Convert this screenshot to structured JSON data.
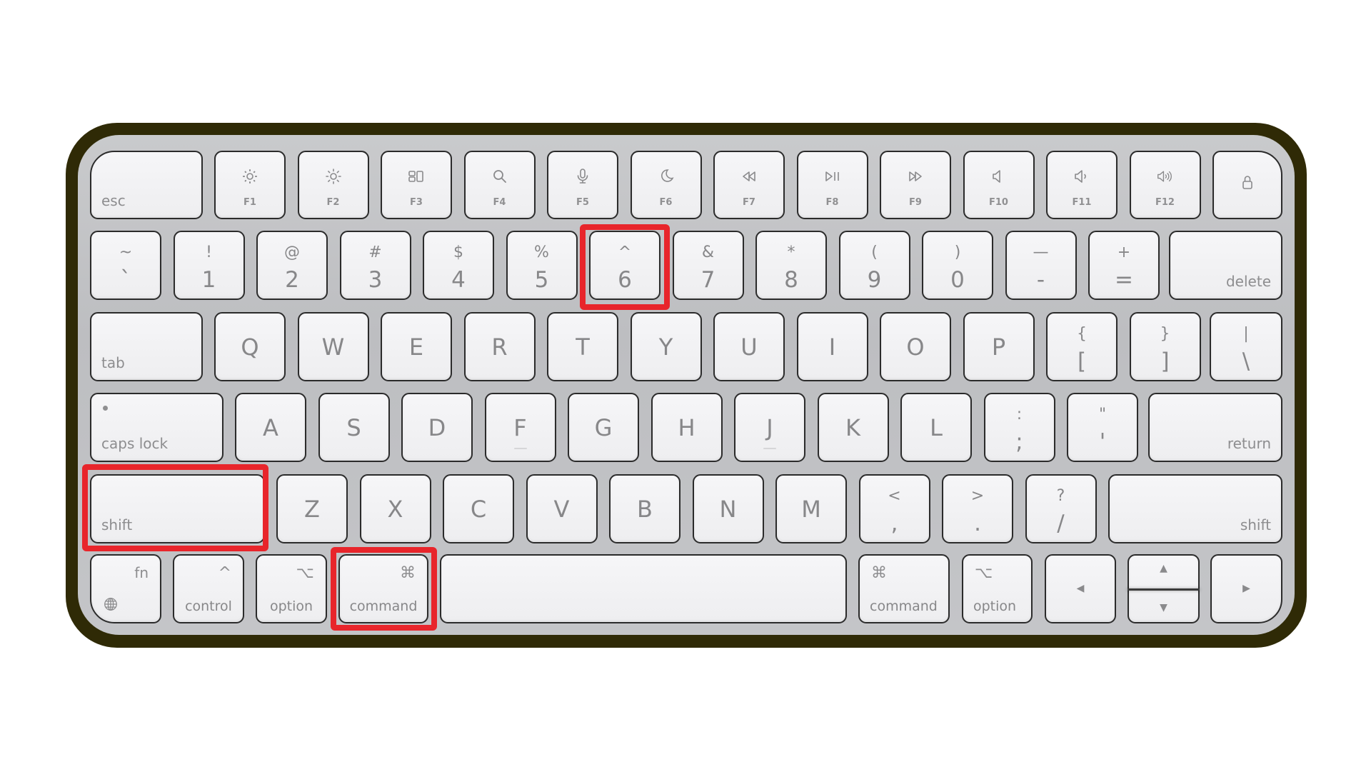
{
  "keyboard": {
    "name": "Apple Magic Keyboard",
    "highlight_color": "#e8252b",
    "frame_color": "#2f2a06",
    "highlighted_keys": [
      "shift",
      "command",
      "6"
    ],
    "row1": [
      {
        "id": "esc",
        "label": "esc"
      },
      {
        "id": "f1",
        "label": "F1",
        "icon": "brightness-down-icon"
      },
      {
        "id": "f2",
        "label": "F2",
        "icon": "brightness-up-icon"
      },
      {
        "id": "f3",
        "label": "F3",
        "icon": "mission-control-icon"
      },
      {
        "id": "f4",
        "label": "F4",
        "icon": "search-icon"
      },
      {
        "id": "f5",
        "label": "F5",
        "icon": "microphone-icon"
      },
      {
        "id": "f6",
        "label": "F6",
        "icon": "moon-icon"
      },
      {
        "id": "f7",
        "label": "F7",
        "icon": "rewind-icon"
      },
      {
        "id": "f8",
        "label": "F8",
        "icon": "play-pause-icon"
      },
      {
        "id": "f9",
        "label": "F9",
        "icon": "fast-forward-icon"
      },
      {
        "id": "f10",
        "label": "F10",
        "icon": "mute-icon"
      },
      {
        "id": "f11",
        "label": "F11",
        "icon": "volume-down-icon"
      },
      {
        "id": "f12",
        "label": "F12",
        "icon": "volume-up-icon"
      },
      {
        "id": "lock",
        "label": "",
        "icon": "lock-icon"
      }
    ],
    "row2": [
      {
        "id": "backtick",
        "upper": "~",
        "lower": "`"
      },
      {
        "id": "1",
        "upper": "!",
        "lower": "1"
      },
      {
        "id": "2",
        "upper": "@",
        "lower": "2"
      },
      {
        "id": "3",
        "upper": "#",
        "lower": "3"
      },
      {
        "id": "4",
        "upper": "$",
        "lower": "4"
      },
      {
        "id": "5",
        "upper": "%",
        "lower": "5"
      },
      {
        "id": "6",
        "upper": "^",
        "lower": "6"
      },
      {
        "id": "7",
        "upper": "&",
        "lower": "7"
      },
      {
        "id": "8",
        "upper": "*",
        "lower": "8"
      },
      {
        "id": "9",
        "upper": "(",
        "lower": "9"
      },
      {
        "id": "0",
        "upper": ")",
        "lower": "0"
      },
      {
        "id": "minus",
        "upper": "—",
        "lower": "-"
      },
      {
        "id": "equals",
        "upper": "+",
        "lower": "="
      },
      {
        "id": "delete",
        "label": "delete"
      }
    ],
    "row3": [
      {
        "id": "tab",
        "label": "tab"
      },
      {
        "id": "q",
        "letter": "Q"
      },
      {
        "id": "w",
        "letter": "W"
      },
      {
        "id": "e",
        "letter": "E"
      },
      {
        "id": "r",
        "letter": "R"
      },
      {
        "id": "t",
        "letter": "T"
      },
      {
        "id": "y",
        "letter": "Y"
      },
      {
        "id": "u",
        "letter": "U"
      },
      {
        "id": "i",
        "letter": "I"
      },
      {
        "id": "o",
        "letter": "O"
      },
      {
        "id": "p",
        "letter": "P"
      },
      {
        "id": "lbracket",
        "upper": "{",
        "lower": "["
      },
      {
        "id": "rbracket",
        "upper": "}",
        "lower": "]"
      },
      {
        "id": "backslash",
        "upper": "|",
        "lower": "\\"
      }
    ],
    "row4": [
      {
        "id": "caps-lock",
        "label": "caps lock"
      },
      {
        "id": "a",
        "letter": "A"
      },
      {
        "id": "s",
        "letter": "S"
      },
      {
        "id": "d",
        "letter": "D"
      },
      {
        "id": "f",
        "letter": "F",
        "bump": true
      },
      {
        "id": "g",
        "letter": "G"
      },
      {
        "id": "h",
        "letter": "H"
      },
      {
        "id": "j",
        "letter": "J",
        "bump": true
      },
      {
        "id": "k",
        "letter": "K"
      },
      {
        "id": "l",
        "letter": "L"
      },
      {
        "id": "semicolon",
        "upper": ":",
        "lower": ";"
      },
      {
        "id": "quote",
        "upper": "\"",
        "lower": "'"
      },
      {
        "id": "return",
        "label": "return"
      }
    ],
    "row5": [
      {
        "id": "shift",
        "label": "shift"
      },
      {
        "id": "z",
        "letter": "Z"
      },
      {
        "id": "x",
        "letter": "X"
      },
      {
        "id": "c",
        "letter": "C"
      },
      {
        "id": "v",
        "letter": "V"
      },
      {
        "id": "b",
        "letter": "B"
      },
      {
        "id": "n",
        "letter": "N"
      },
      {
        "id": "m",
        "letter": "M"
      },
      {
        "id": "comma",
        "upper": "<",
        "lower": ","
      },
      {
        "id": "period",
        "upper": ">",
        "lower": "."
      },
      {
        "id": "slash",
        "upper": "?",
        "lower": "/"
      },
      {
        "id": "right-shift",
        "label": "shift"
      }
    ],
    "row6": [
      {
        "id": "fn",
        "label": "fn",
        "icon": "globe-icon"
      },
      {
        "id": "control",
        "label": "control",
        "symbol": "^"
      },
      {
        "id": "option",
        "label": "option",
        "symbol": "⌥"
      },
      {
        "id": "command",
        "label": "command",
        "symbol": "⌘"
      },
      {
        "id": "space",
        "label": ""
      },
      {
        "id": "right-command",
        "label": "command",
        "symbol": "⌘"
      },
      {
        "id": "right-option",
        "label": "option",
        "symbol": "⌥"
      },
      {
        "id": "left-arrow",
        "arrow": "◀"
      },
      {
        "id": "up-down-arrow",
        "arrow_up": "▲",
        "arrow_down": "▼"
      },
      {
        "id": "right-arrow",
        "arrow": "▶"
      }
    ]
  }
}
